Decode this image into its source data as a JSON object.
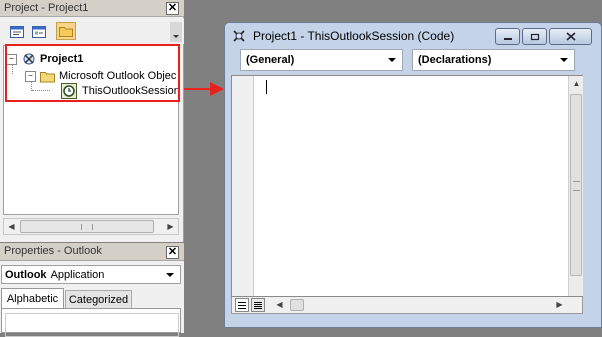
{
  "project_panel": {
    "title": "Project - Project1",
    "close": "✕",
    "toolbar": [
      "view-code-icon",
      "view-object-icon",
      "toggle-folders-icon"
    ],
    "tree": {
      "root": "Project1",
      "folder": "Microsoft Outlook Objec",
      "item": "ThisOutlookSession"
    }
  },
  "properties_panel": {
    "title": "Properties - Outlook",
    "close": "✕",
    "object_name": "Outlook",
    "object_type": "Application",
    "tabs": [
      "Alphabetic",
      "Categorized"
    ]
  },
  "code_window": {
    "title": "Project1 - ThisOutlookSession (Code)",
    "object_combo": "(General)",
    "proc_combo": "(Declarations)"
  },
  "annotation": {
    "highlight_color": "#e8201e",
    "arrow_color": "#e8201e"
  }
}
